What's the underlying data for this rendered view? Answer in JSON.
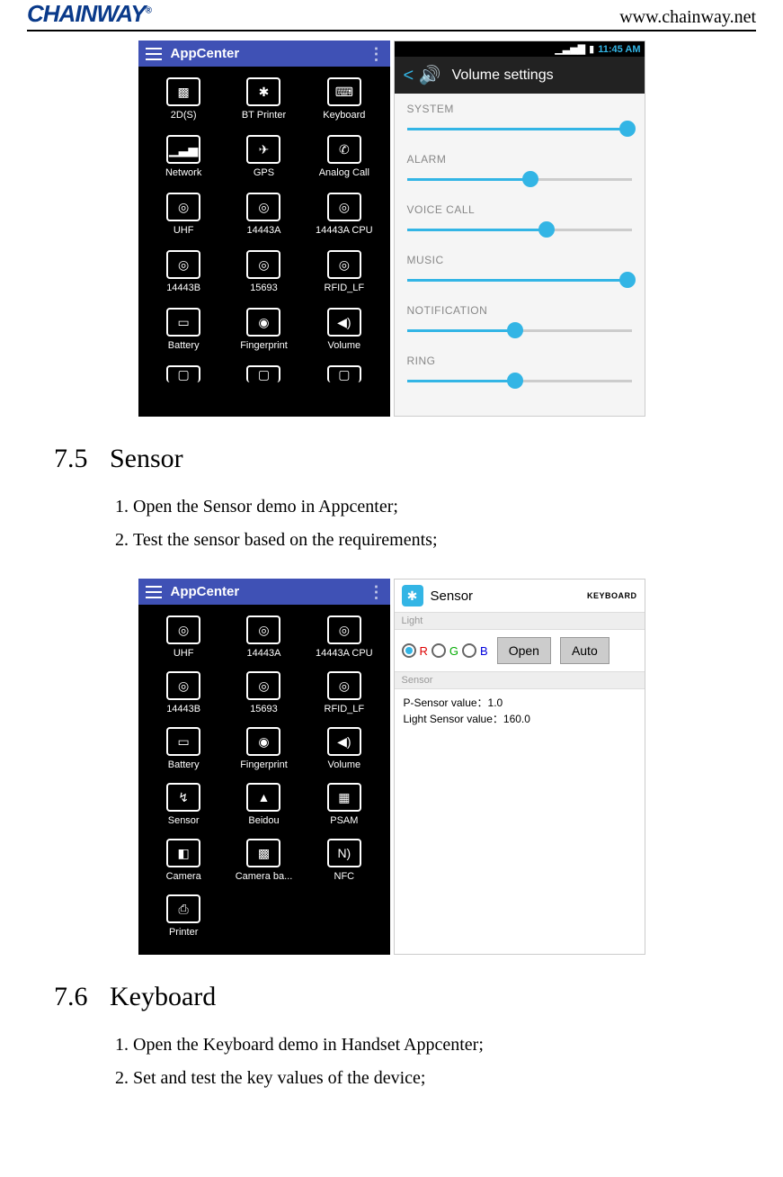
{
  "header": {
    "logo": "CHAINWAY",
    "reg": "®",
    "url": "www.chainway.net"
  },
  "fig1": {
    "appcenter_title": "AppCenter",
    "tiles": [
      "2D(S)",
      "BT Printer",
      "Keyboard",
      "Network",
      "GPS",
      "Analog Call",
      "UHF",
      "14443A",
      "14443A CPU",
      "14443B",
      "15693",
      "RFID_LF",
      "Battery",
      "Fingerprint",
      "Volume"
    ],
    "volume": {
      "title": "Volume settings",
      "clock": "11:45 AM",
      "sliders": [
        {
          "label": "SYSTEM",
          "pct": 98
        },
        {
          "label": "ALARM",
          "pct": 55
        },
        {
          "label": "VOICE CALL",
          "pct": 62
        },
        {
          "label": "MUSIC",
          "pct": 98
        },
        {
          "label": "NOTIFICATION",
          "pct": 48
        },
        {
          "label": "RING",
          "pct": 48
        }
      ]
    }
  },
  "sec75": {
    "num": "7.5",
    "title": "Sensor",
    "steps": [
      "Open the Sensor demo in Appcenter;",
      "Test the sensor based on the requirements;"
    ]
  },
  "fig2": {
    "appcenter_title": "AppCenter",
    "tiles": [
      "UHF",
      "14443A",
      "14443A CPU",
      "14443B",
      "15693",
      "RFID_LF",
      "Battery",
      "Fingerprint",
      "Volume",
      "Sensor",
      "Beidou",
      "PSAM",
      "Camera",
      "Camera ba...",
      "NFC",
      "Printer"
    ],
    "sensor": {
      "title": "Sensor",
      "kbd": "KEYBOARD",
      "group_light": "Light",
      "radios": {
        "r": "R",
        "g": "G",
        "b": "B"
      },
      "btn_open": "Open",
      "btn_auto": "Auto",
      "group_sensor": "Sensor",
      "p_line": "P-Sensor value：1.0",
      "l_line": "Light Sensor value：160.0"
    }
  },
  "sec76": {
    "num": "7.6",
    "title": "Keyboard",
    "steps": [
      "Open the Keyboard demo in Handset Appcenter;",
      "Set and test the key values of the device;"
    ]
  }
}
